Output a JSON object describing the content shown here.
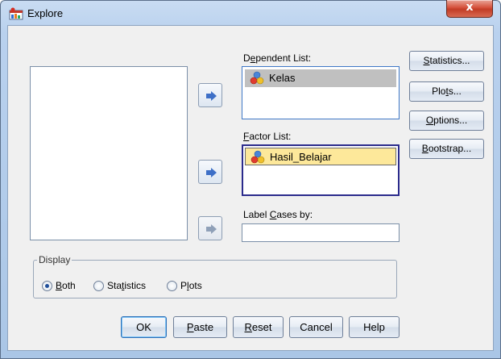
{
  "window": {
    "title": "Explore",
    "close_glyph": "x"
  },
  "lists": {
    "dependent": {
      "label_prefix": "D",
      "label_mnemonic": "e",
      "label_rest": "pendent List:",
      "items": [
        "Kelas"
      ]
    },
    "factor": {
      "label_mnemonic": "F",
      "label_rest": "actor List:",
      "items": [
        "Hasil_Belajar"
      ]
    },
    "label_cases": {
      "label_prefix": "Label ",
      "label_mnemonic": "C",
      "label_rest": "ases by:"
    }
  },
  "side_buttons": {
    "statistics": {
      "mn": "S",
      "rest": "tatistics..."
    },
    "plots": {
      "pre": "Plo",
      "mn": "t",
      "rest": "s..."
    },
    "options": {
      "mn": "O",
      "rest": "ptions..."
    },
    "bootstrap": {
      "mn": "B",
      "rest": "ootstrap..."
    }
  },
  "display": {
    "title": "Display",
    "both": {
      "mn": "B",
      "rest": "oth",
      "selected": true
    },
    "statistics": {
      "pre": "Sta",
      "mn": "t",
      "rest": "istics",
      "selected": false
    },
    "plots": {
      "pre": "P",
      "mn": "l",
      "rest": "ots",
      "selected": false
    }
  },
  "bottom_buttons": {
    "ok": "OK",
    "paste": {
      "mn": "P",
      "rest": "aste"
    },
    "reset": {
      "mn": "R",
      "rest": "eset"
    },
    "cancel": "Cancel",
    "help": "Help"
  },
  "colors": {
    "accent_arrow": "#3d6fc7",
    "selected_item": "#c0c0c0",
    "focused_item": "#fde89a"
  },
  "icons": [
    "explore-app-icon",
    "nominal-variable-icon",
    "arrow-right-icon"
  ]
}
